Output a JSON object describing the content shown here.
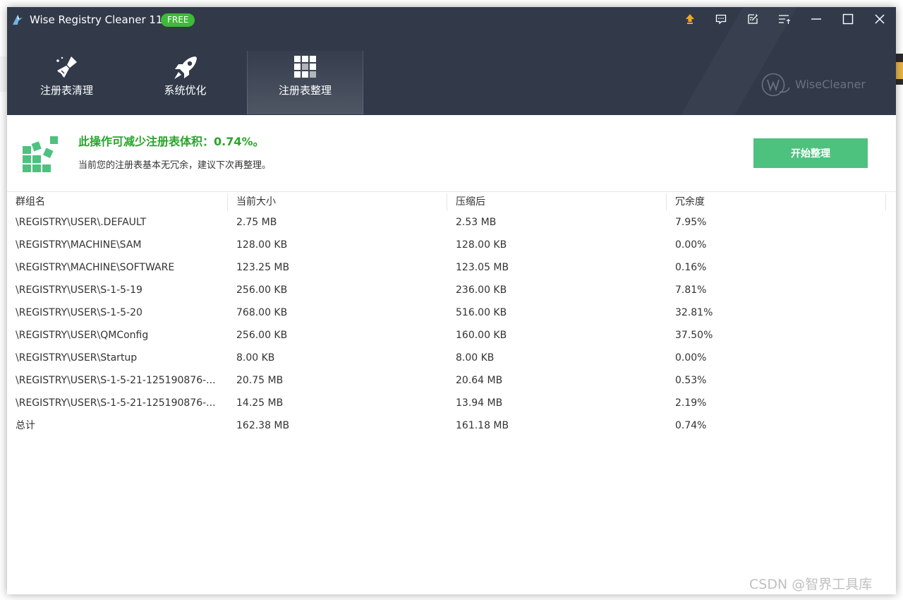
{
  "window": {
    "title": "Wise Registry Cleaner 11",
    "badge": "FREE"
  },
  "titlebar_buttons": [
    {
      "name": "upgrade-icon",
      "color": "#f5a623"
    },
    {
      "name": "feedback-icon"
    },
    {
      "name": "edit-icon"
    },
    {
      "name": "menu-icon"
    },
    {
      "name": "minimize-icon"
    },
    {
      "name": "maximize-icon"
    },
    {
      "name": "close-icon"
    }
  ],
  "nav": {
    "tabs": [
      {
        "label": "注册表清理",
        "icon": "broom-icon",
        "active": false
      },
      {
        "label": "系统优化",
        "icon": "rocket-icon",
        "active": false
      },
      {
        "label": "注册表整理",
        "icon": "blocks-icon",
        "active": true
      }
    ]
  },
  "brand": {
    "label": "WiseCleaner"
  },
  "summary": {
    "title": "此操作可减少注册表体积：0.74%。",
    "subtitle": "当前您的注册表基本无冗余，建议下次再整理。",
    "start_button": "开始整理",
    "accent_color": "#2aa52a",
    "button_color": "#4cc27e"
  },
  "table": {
    "headers": [
      "群组名",
      "当前大小",
      "压缩后",
      "冗余度"
    ],
    "rows": [
      [
        "\\REGISTRY\\USER\\.DEFAULT",
        "2.75 MB",
        "2.53 MB",
        "7.95%"
      ],
      [
        "\\REGISTRY\\MACHINE\\SAM",
        "128.00 KB",
        "128.00 KB",
        "0.00%"
      ],
      [
        "\\REGISTRY\\MACHINE\\SOFTWARE",
        "123.25 MB",
        "123.05 MB",
        "0.16%"
      ],
      [
        "\\REGISTRY\\USER\\S-1-5-19",
        "256.00 KB",
        "236.00 KB",
        "7.81%"
      ],
      [
        "\\REGISTRY\\USER\\S-1-5-20",
        "768.00 KB",
        "516.00 KB",
        "32.81%"
      ],
      [
        "\\REGISTRY\\USER\\QMConfig",
        "256.00 KB",
        "160.00 KB",
        "37.50%"
      ],
      [
        "\\REGISTRY\\USER\\Startup",
        "8.00 KB",
        "8.00 KB",
        "0.00%"
      ],
      [
        "\\REGISTRY\\USER\\S-1-5-21-125190876-...",
        "20.75 MB",
        "20.64 MB",
        "0.53%"
      ],
      [
        "\\REGISTRY\\USER\\S-1-5-21-125190876-...",
        "14.25 MB",
        "13.94 MB",
        "2.19%"
      ],
      [
        "总计",
        "162.38 MB",
        "161.18 MB",
        "0.74%"
      ]
    ]
  },
  "watermark": "CSDN @智界工具库",
  "colors": {
    "header_bg": "#323a4a",
    "badge_green": "#3fba3a"
  }
}
